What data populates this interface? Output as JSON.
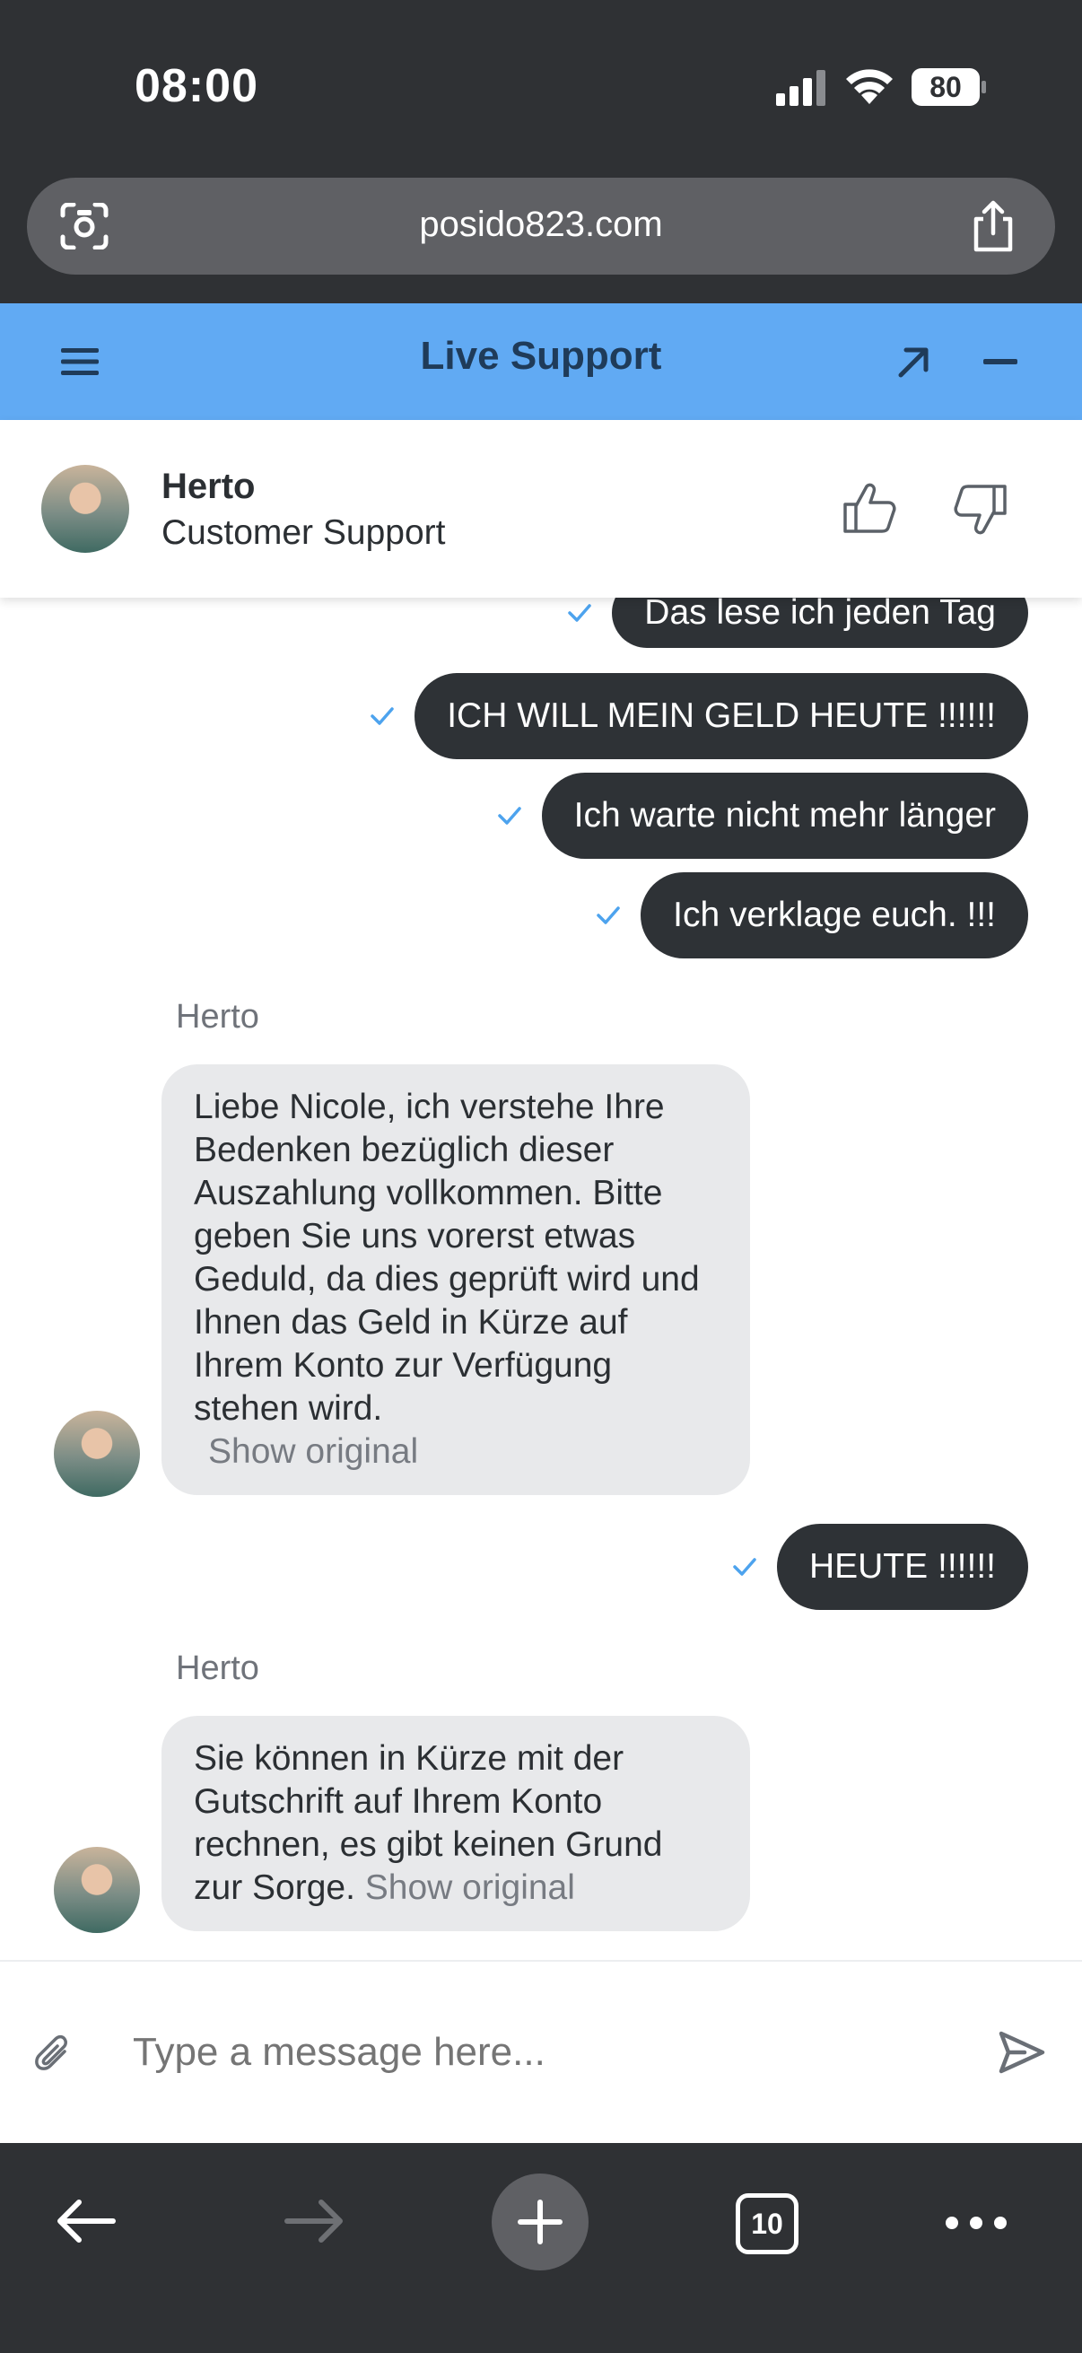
{
  "status_bar": {
    "time": "08:00",
    "battery": "80"
  },
  "browser": {
    "url": "posido823.com",
    "tab_count": "10"
  },
  "header": {
    "title": "Live Support"
  },
  "agent": {
    "name": "Herto",
    "role": "Customer Support"
  },
  "messages": {
    "out1": "Das lese ich jeden Tag",
    "out2": "ICH WILL MEIN GELD HEUTE !!!!!!",
    "out3": "Ich warte nicht mehr länger",
    "out4": "Ich verklage euch. !!!",
    "in1_sender": "Herto",
    "in1_text": "Liebe Nicole, ich verstehe Ihre Bedenken bezüglich dieser Auszahlung vollkommen. Bitte geben Sie uns vorerst etwas Geduld, da dies geprüft wird und Ihnen das Geld in Kürze auf Ihrem Konto zur Verfügung stehen wird.",
    "in1_show_original": "Show original",
    "out5": "HEUTE !!!!!!",
    "in2_sender": "Herto",
    "in2_text": "Sie können in Kürze mit der Gutschrift auf Ihrem Konto rechnen, es gibt keinen Grund zur Sorge.",
    "in2_show_original": "Show original"
  },
  "composer": {
    "placeholder": "Type a message here..."
  },
  "colors": {
    "header_bg": "#61aaf3",
    "header_text": "#1f3b59",
    "outgoing_bubble": "#2e3236",
    "incoming_bubble": "#e8e9eb",
    "check_mark": "#4da3ee",
    "browser_chrome": "#2f3134"
  }
}
